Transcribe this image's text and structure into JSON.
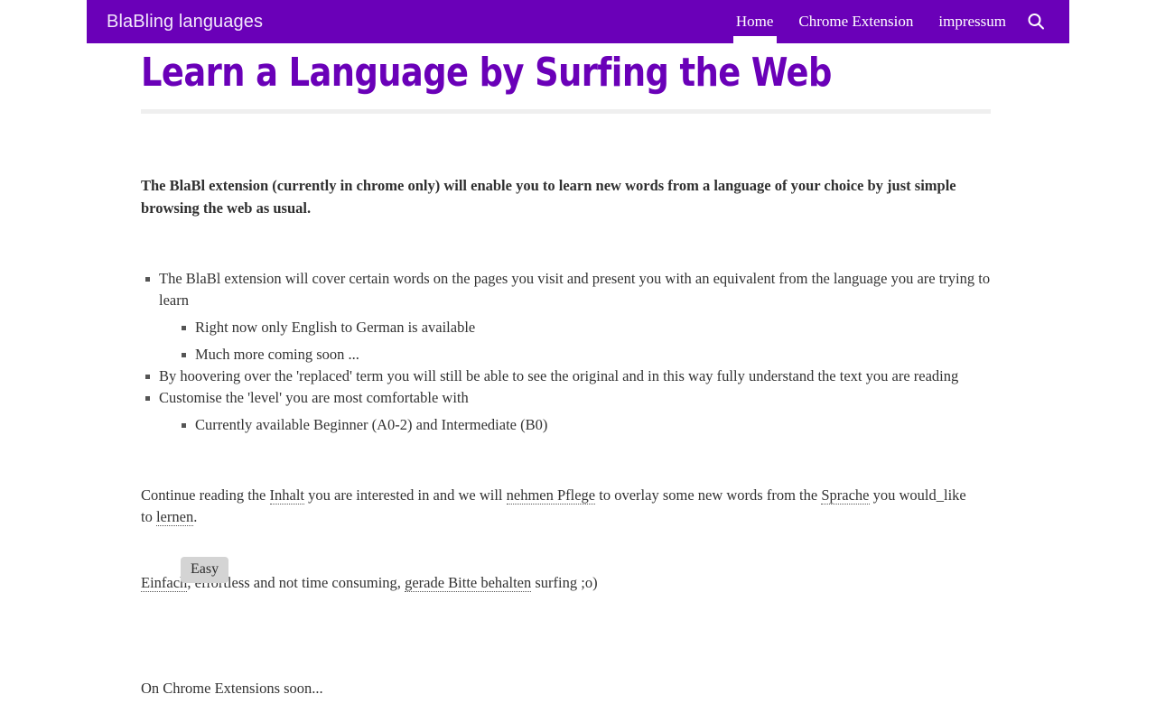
{
  "header": {
    "brand": "BlaBling languages",
    "background_color": "#6a00b8",
    "nav": [
      {
        "label": "Home",
        "active": true
      },
      {
        "label": "Chrome Extension",
        "active": false
      },
      {
        "label": "impressum",
        "active": false
      }
    ],
    "search_icon": "search-icon"
  },
  "page": {
    "title": "Learn a Language by Surfing the Web",
    "title_color": "#6a00b8",
    "intro": "The BlaBl extension (currently in chrome only) will enable you to learn new words from a language of your choice by just simple browsing the web as usual.",
    "features": [
      {
        "text": "The BlaBl extension will cover certain words on the pages you visit and present you with an equivalent from the language you are trying to learn",
        "children": [
          "Right now only English to German is available",
          "Much more coming soon ..."
        ]
      },
      {
        "text": "By hoovering over the 'replaced' term you will still be able to see the original and in this way fully understand the text you are reading",
        "children": []
      },
      {
        "text": "Customise the 'level' you are most comfortable with",
        "children": [
          "Currently available Beginner (A0-2) and Intermediate (B0)"
        ]
      }
    ],
    "continue_paragraph": {
      "part1": "Continue reading the ",
      "word1": "Inhalt",
      "part2": " you are interested in and we will ",
      "word2": "nehmen Pflege",
      "part3": " to overlay some new words from the ",
      "word3": "Sprache",
      "part4": " you would_like to ",
      "word4": "lernen",
      "part5": "."
    },
    "tooltip": {
      "text": "Easy",
      "background_color": "#d4d4d4"
    },
    "easy_paragraph": {
      "word1": "Einfach",
      "part1": ", effortless and not time consuming, ",
      "word2": "gerade Bitte behalten",
      "part2": " surfing ;o)"
    },
    "footer_note": "On Chrome Extensions soon..."
  }
}
